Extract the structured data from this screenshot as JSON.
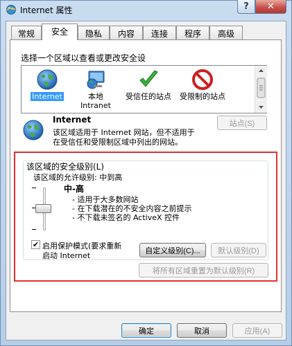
{
  "window": {
    "title": "Internet 属性",
    "help_label": "?",
    "close_label": "✕"
  },
  "tabs": [
    {
      "label": "常规",
      "active": false
    },
    {
      "label": "安全",
      "active": true
    },
    {
      "label": "隐私",
      "active": false
    },
    {
      "label": "内容",
      "active": false
    },
    {
      "label": "连接",
      "active": false
    },
    {
      "label": "程序",
      "active": false
    },
    {
      "label": "高级",
      "active": false
    }
  ],
  "security": {
    "zone_prompt": "选择一个区域以查看或更改安全设",
    "zones": [
      {
        "label": "Internet",
        "selected": true,
        "icon": "globe-icon"
      },
      {
        "label": "本地 Intranet",
        "selected": false,
        "icon": "intranet-icon"
      },
      {
        "label": "受信任的站点",
        "selected": false,
        "icon": "trusted-check-icon"
      },
      {
        "label": "受限制的站点",
        "selected": false,
        "icon": "restricted-icon"
      }
    ],
    "zone_title": "Internet",
    "zone_desc_line1": "该区域适用于 Internet 网站，但不适用于",
    "zone_desc_line2": "在受信任和受限制区域中列出的网站。",
    "sites_button": "站点(S)",
    "level_group_title": "该区域的安全级别(L)",
    "allowed_levels": "该区域的允许级别: 中到高",
    "level_name": "中-高",
    "level_bullets": [
      "- 适用于大多数网站",
      "- 在下载潜在的不安全内容之前提示",
      "- 不下载未签名的 ActiveX 控件"
    ],
    "slider_level": "中-高",
    "protected_mode_line1": "启用保护模式(要求重新",
    "protected_mode_line2": "启动 Internet",
    "protected_mode_checked": true,
    "custom_level_button": "自定义级别(C)...",
    "default_level_button": "默认级别(D)",
    "reset_all_button": "将所有区域重置为默认级别(R)"
  },
  "footer": {
    "ok": "确定",
    "cancel": "取消",
    "apply": "应用(A)"
  },
  "colors": {
    "highlight_frame": "#e0302c",
    "selection": "#3399ff",
    "close_button": "#c75050"
  }
}
